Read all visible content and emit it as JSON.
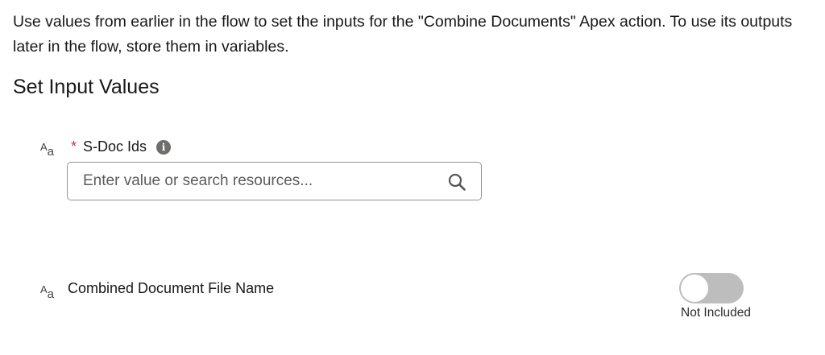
{
  "intro_text": "Use values from earlier in the flow to set the inputs for the \"Combine Documents\" Apex action. To use its outputs later in the flow, store them in variables.",
  "section_title": "Set Input Values",
  "fields": [
    {
      "type_icon_upper": "A",
      "type_icon_lower": "a",
      "required_marker": "*",
      "label": "S-Doc Ids",
      "info_icon": "info-icon",
      "value": "",
      "placeholder": "Enter value or search resources...",
      "search_icon": "search-icon"
    },
    {
      "type_icon_upper": "A",
      "type_icon_lower": "a",
      "label": "Combined Document File Name",
      "toggle_on": false,
      "toggle_status": "Not Included"
    }
  ],
  "colors": {
    "required": "#c23934",
    "toggle_off": "#bdbdbd",
    "info_icon": "#706e6b"
  }
}
